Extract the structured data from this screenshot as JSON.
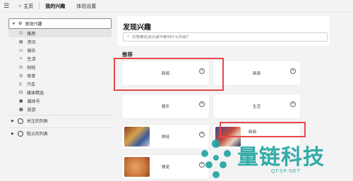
{
  "topbar": {
    "menu_icon": "hamburger-icon",
    "home_label": "主页",
    "tabs": [
      {
        "label": "我的兴趣",
        "active": true
      },
      {
        "label": "体验设置",
        "active": false
      }
    ]
  },
  "sidebar": {
    "header_label": "发现兴趣",
    "items": [
      {
        "label": "推荐",
        "icon": "person-icon",
        "active": true
      },
      {
        "label": "资讯",
        "icon": "doc-icon",
        "active": false
      },
      {
        "label": "娱乐",
        "icon": "screen-icon",
        "active": false
      },
      {
        "label": "生活",
        "icon": "sun-icon",
        "active": false
      },
      {
        "label": "财经",
        "icon": "chart-icon",
        "active": false
      },
      {
        "label": "体育",
        "icon": "ball-icon",
        "active": false
      },
      {
        "label": "汽车",
        "icon": "car-icon",
        "active": false
      },
      {
        "label": "媒体精选",
        "icon": "media-icon",
        "active": false
      },
      {
        "label": "媒体号",
        "icon": "account-icon",
        "active": false
      },
      {
        "label": "旅游",
        "icon": "luggage-icon",
        "active": false
      }
    ],
    "groups": [
      {
        "label": "关注的列表"
      },
      {
        "label": "阻止的列表"
      }
    ]
  },
  "main": {
    "title": "发现兴趣",
    "search_placeholder": "您想要在资讯源中看到什么内容?",
    "section_title": "推荐",
    "cards": [
      {
        "label": "新闻",
        "has_thumb": false,
        "highlighted": true
      },
      {
        "label": "新闻",
        "has_thumb": false,
        "highlighted": false
      },
      {
        "label": "娱乐",
        "has_thumb": false,
        "highlighted": false
      },
      {
        "label": "生活",
        "has_thumb": false,
        "highlighted": false
      },
      {
        "label": "财经",
        "has_thumb": true,
        "highlighted": false
      },
      {
        "label": "新闻",
        "has_thumb": true,
        "highlighted": true
      },
      {
        "label": "萌宠",
        "has_thumb": true,
        "highlighted": false
      }
    ]
  },
  "watermark": {
    "text": "量链科技",
    "sub": "QFSP.NET"
  },
  "colors": {
    "highlight": "#e8464a",
    "watermark": "#1fa4a0"
  }
}
